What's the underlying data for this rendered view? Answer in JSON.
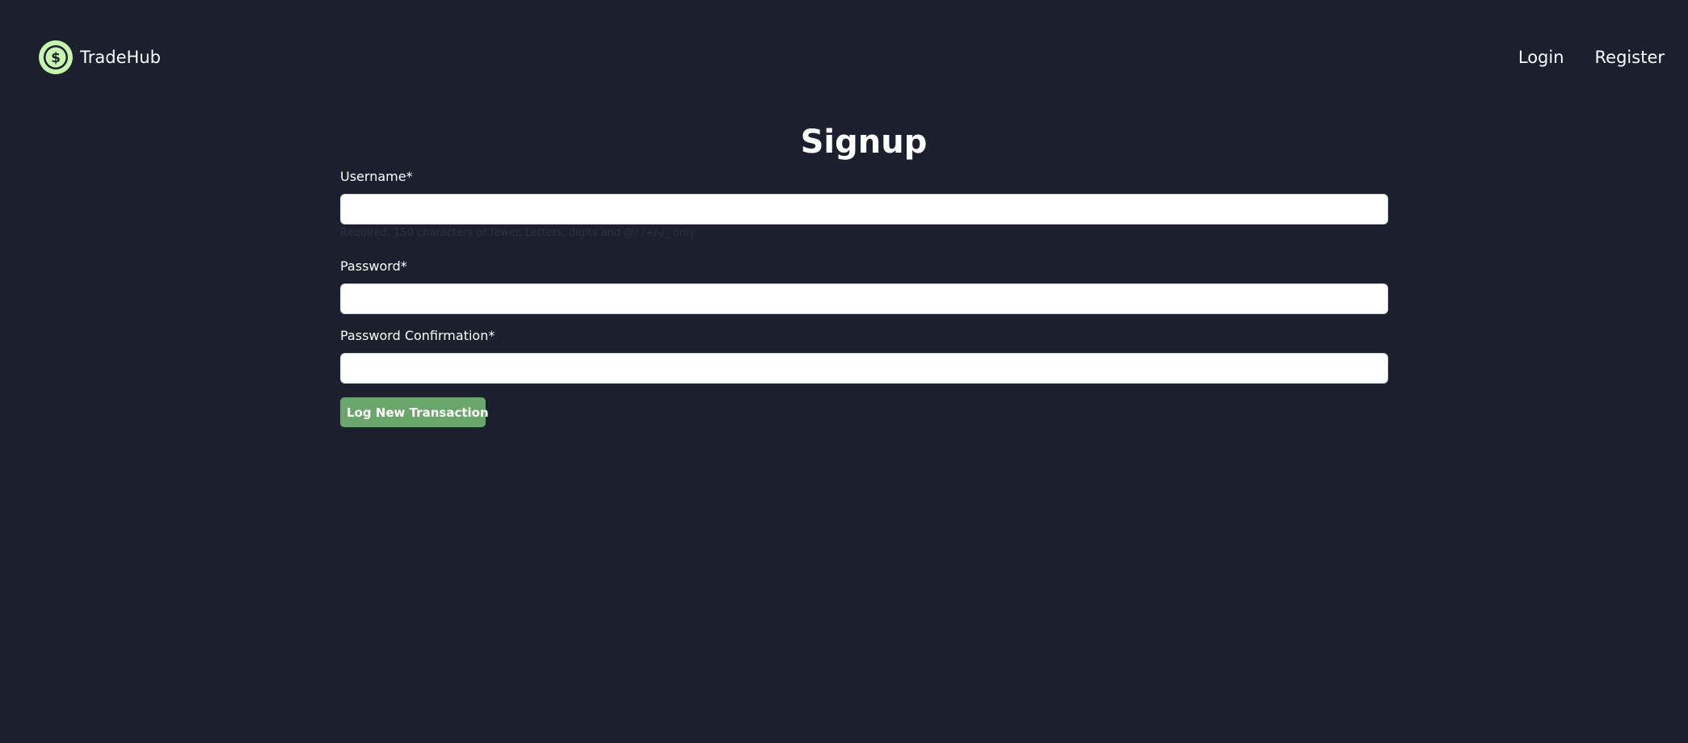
{
  "navbar": {
    "brand_name": "TradeHub",
    "logo_icon": "dollar-coin-icon",
    "links": [
      {
        "label": "Login"
      },
      {
        "label": "Register"
      }
    ]
  },
  "page": {
    "title": "Signup"
  },
  "form": {
    "username": {
      "label": "Username*",
      "value": "",
      "help_text": "Required. 150 characters or fewer. Letters, digits and @/./+/-/_ only."
    },
    "password": {
      "label": "Password*",
      "value": ""
    },
    "password_confirmation": {
      "label": "Password Confirmation*",
      "value": ""
    },
    "submit_label": "Log New Transaction"
  },
  "colors": {
    "background": "#1b1f2e",
    "accent_button": "#6aa66b",
    "logo_ring": "#c6f5b0"
  }
}
